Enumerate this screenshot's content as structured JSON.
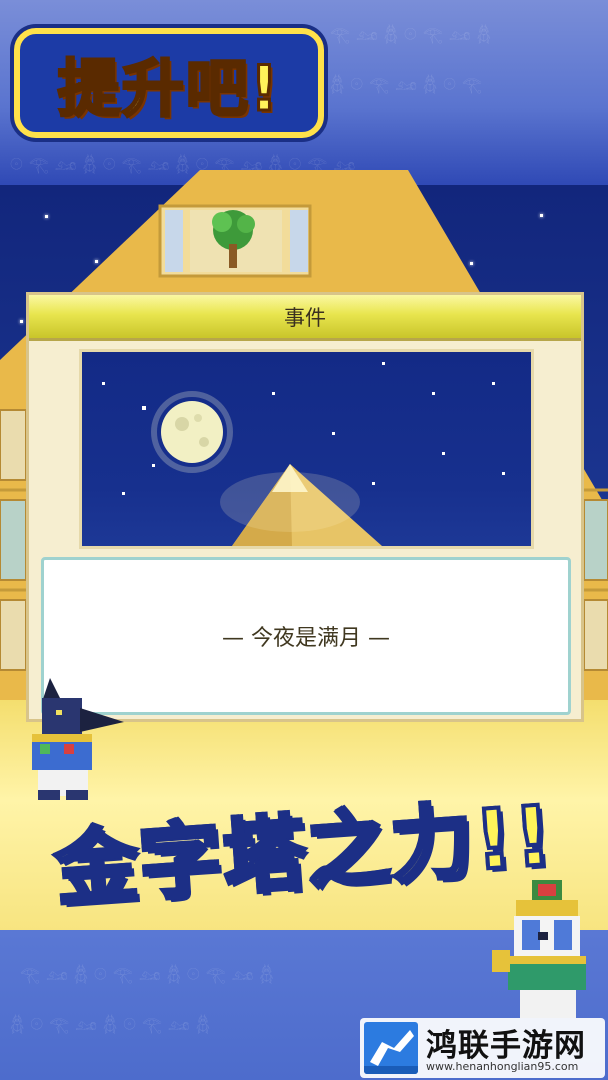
{
  "headline_top": "提升吧!",
  "dialog": {
    "title": "事件",
    "message": "— 今夜是满月 —"
  },
  "headline_bottom": "金字塔之力!!",
  "watermark": {
    "title": "鸿联手游网",
    "url": "www.henanhonglian95.com"
  },
  "colors": {
    "headline_text": "#fff25a",
    "dialog_header": "#e8e54e",
    "night_sky": "#132a86",
    "sand": "#f6e27a"
  }
}
